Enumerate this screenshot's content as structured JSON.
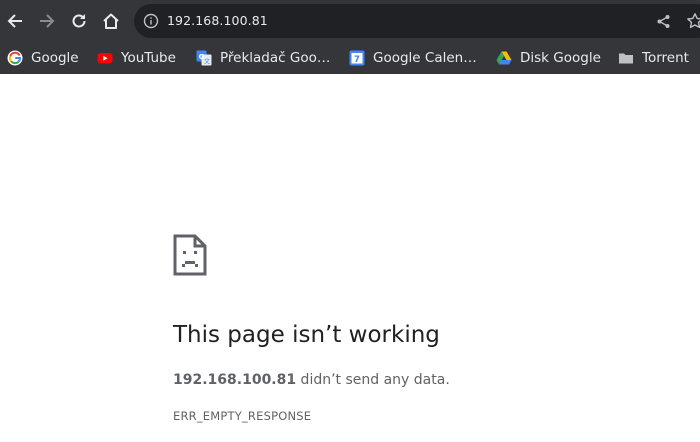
{
  "toolbar": {
    "url": "192.168.100.81"
  },
  "bookmarks": [
    {
      "label": "Google",
      "icon": "google-icon"
    },
    {
      "label": "YouTube",
      "icon": "youtube-icon"
    },
    {
      "label": "Překladač Goo…",
      "icon": "google-translate-icon"
    },
    {
      "label": "Google Calen…",
      "icon": "google-calendar-icon",
      "icon_text": "7"
    },
    {
      "label": "Disk Google",
      "icon": "google-drive-icon"
    },
    {
      "label": "Torrent",
      "icon": "folder-icon"
    }
  ],
  "error": {
    "title": "This page isn’t working",
    "host": "192.168.100.81",
    "message": " didn’t send any data.",
    "code": "ERR_EMPTY_RESPONSE"
  },
  "colors": {
    "toolbar_bg": "#35363a",
    "omnibox_bg": "#202124",
    "page_bg": "#ffffff",
    "title_text": "#202124",
    "body_text": "#5f6368"
  }
}
